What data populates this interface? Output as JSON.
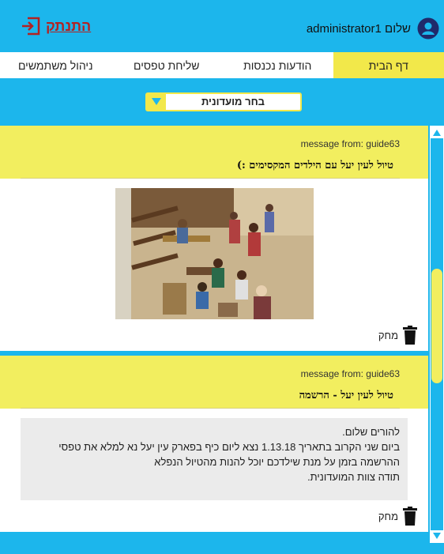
{
  "header": {
    "logout_label": "התנתק",
    "greeting": "שלום administrator1"
  },
  "nav": {
    "tabs": [
      {
        "label": "דף הבית",
        "active": true
      },
      {
        "label": "הודעות נכנסות",
        "active": false
      },
      {
        "label": "שליחת טפסים",
        "active": false
      },
      {
        "label": "ניהול משתמשים",
        "active": false
      }
    ]
  },
  "club_select": {
    "selected": "בחר מועדונית"
  },
  "messages": [
    {
      "from": "message from: guide63",
      "title": "טיול לעין יעל עם הילדים המקסימים :)",
      "delete_label": "מחק"
    },
    {
      "from": "message from: guide63",
      "title": "טיול לעין יעל - הרשמה",
      "body_lines": [
        "להורים שלום.",
        "ביום שני הקרוב בתאריך 1.13.18 נצא ליום כיף בפארק עין יעל נא למלא את טפסי",
        "ההרשמה בזמן על מנת שילדכם יוכל להנות מהטיול הנפלא",
        "תודה צוות המועדונית."
      ],
      "delete_label": "מחק"
    }
  ],
  "colors": {
    "primary_blue": "#1cb6ec",
    "accent_yellow": "#f2ee5f",
    "logout_red": "#b22222"
  },
  "icons": {
    "logout": "logout-icon",
    "avatar": "user-avatar-icon",
    "dropdown": "dropdown-arrow-icon",
    "delete": "trash-icon"
  }
}
